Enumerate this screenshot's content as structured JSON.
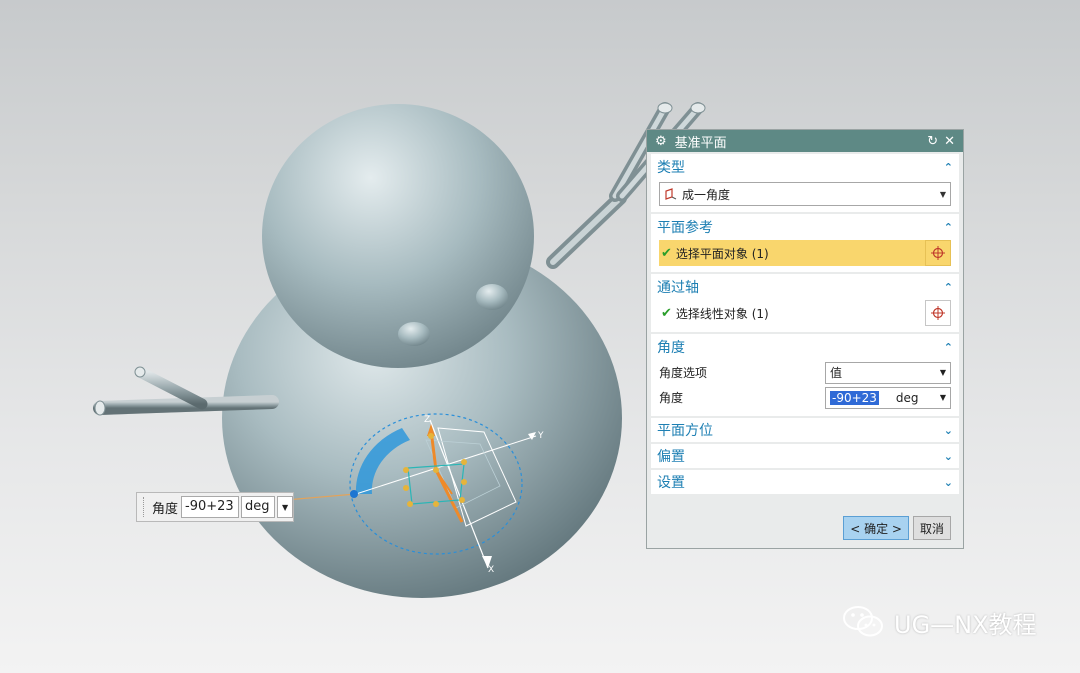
{
  "dialog": {
    "title": "基准平面",
    "sections": {
      "type": {
        "header": "类型",
        "selected": "成一角度"
      },
      "plane_ref": {
        "header": "平面参考",
        "select_label": "选择平面对象 (1)"
      },
      "through_axis": {
        "header": "通过轴",
        "select_label": "选择线性对象 (1)"
      },
      "angle": {
        "header": "角度",
        "option_label": "角度选项",
        "option_value": "值",
        "angle_label": "角度",
        "angle_value": "-90+23",
        "angle_unit": "deg"
      },
      "orientation": {
        "header": "平面方位"
      },
      "offset": {
        "header": "偏置"
      },
      "settings": {
        "header": "设置"
      }
    },
    "buttons": {
      "ok": "< 确定 >",
      "cancel": "取消"
    }
  },
  "floating_input": {
    "label": "角度",
    "value": "-90+23",
    "unit": "deg"
  },
  "gizmo_labels": {
    "z": "Z",
    "y": "Y",
    "x": "X"
  },
  "watermark": {
    "text": "UG—NX教程"
  },
  "colors": {
    "title_bar": "#5e8985",
    "section_header": "#1d7fb3",
    "active_select": "#f9d66d",
    "ok_button": "#a8d2f0"
  }
}
